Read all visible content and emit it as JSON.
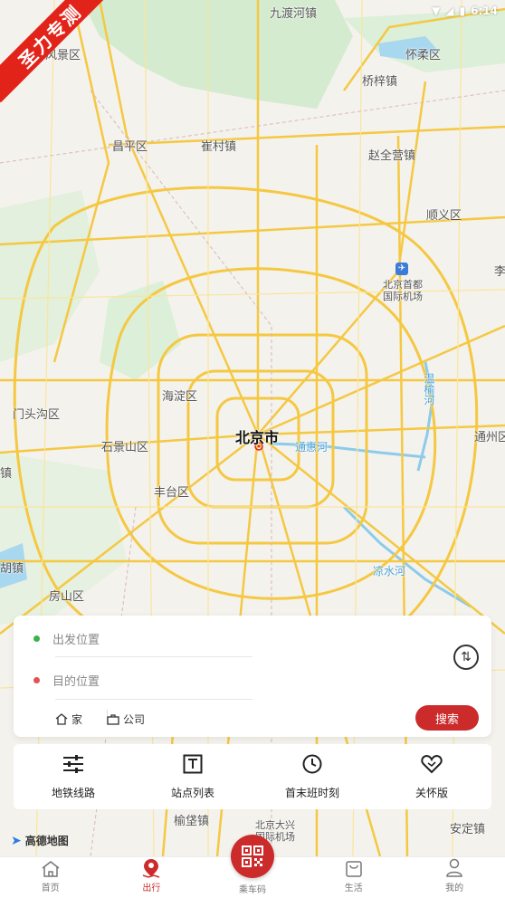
{
  "status": {
    "time": "6:14"
  },
  "ribbon": {
    "text": "圣力专测"
  },
  "map": {
    "city": "北京市",
    "labels": {
      "jiudu": "九渡河镇",
      "huairou": "怀柔区",
      "fengjing": "风景区",
      "qiaozi": "桥梓镇",
      "changping": "昌平区",
      "cuicun": "崔村镇",
      "zhaoquanying": "赵全营镇",
      "shunyi": "顺义区",
      "airport": "北京首都\n国际机场",
      "haidian": "海淀区",
      "mentougou": "门头沟区",
      "shijingshan": "石景山区",
      "fengtai": "丰台区",
      "fangshan": "房山区",
      "tongzhou": "通州区",
      "tonghuihe": "通惠河",
      "wenyuhe": "温榆河",
      "liangshuihe": "凉水河",
      "yufa": "榆垡镇",
      "daxing_airport": "北京大兴\n国际机场",
      "anding": "安定镇",
      "li": "李",
      "zhen1": "镇",
      "zhen2": "胡镇"
    }
  },
  "route": {
    "from_placeholder": "出发位置",
    "to_placeholder": "目的位置",
    "home": "家",
    "company": "公司",
    "search": "搜索"
  },
  "tools": [
    {
      "label": "地铁线路",
      "icon": "sliders-icon"
    },
    {
      "label": "站点列表",
      "icon": "station-list-icon"
    },
    {
      "label": "首末班时刻",
      "icon": "clock-icon"
    },
    {
      "label": "关怀版",
      "icon": "heart-icon"
    }
  ],
  "amap": {
    "text": "高德地图"
  },
  "nav": {
    "home": "首页",
    "travel": "出行",
    "qr": "乘车码",
    "life": "生活",
    "mine": "我的"
  },
  "colors": {
    "accent": "#cc2b2b",
    "ribbon": "#e2231a",
    "road": "#f5c842",
    "water": "#8ccbea",
    "green": "#cfe8cc"
  }
}
